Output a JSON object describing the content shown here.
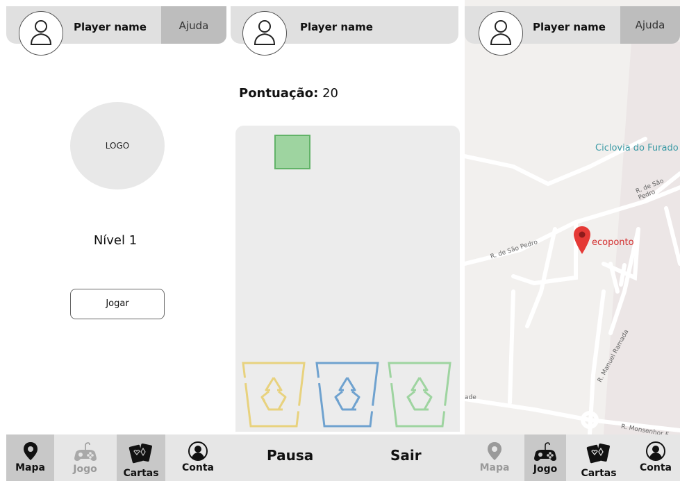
{
  "player": {
    "name": "Player name"
  },
  "header": {
    "help_label": "Ajuda"
  },
  "home": {
    "logo_text": "LOGO",
    "level": "Nível 1",
    "play_label": "Jogar"
  },
  "nav": {
    "items": [
      {
        "label": "Mapa",
        "icon": "map-pin-icon"
      },
      {
        "label": "Jogo",
        "icon": "gamepad-icon"
      },
      {
        "label": "Cartas",
        "icon": "cards-icon"
      },
      {
        "label": "Conta",
        "icon": "account-icon"
      }
    ]
  },
  "game": {
    "score_label": "Pontuação:",
    "score_value": "20",
    "pause_label": "Pausa",
    "exit_label": "Sair",
    "bins": [
      {
        "color": "#e8d27e"
      },
      {
        "color": "#6fa2cf"
      },
      {
        "color": "#9ed4a0"
      }
    ]
  },
  "map": {
    "marker_label": "ecoponto",
    "labels": {
      "ciclovia": "Ciclovia do Furado",
      "street1": "R. de São Pedro",
      "street2": "R. de São Pedro",
      "street3": "R. Manuel Ramada",
      "street4": "R. Monsenhor F",
      "edge_left": "ade"
    }
  },
  "colors": {
    "header_bg": "#e0e0e0",
    "help_bg": "#bdbdbd",
    "nav_bg": "#e6e6e6",
    "nav_active": "#c8c8c8",
    "marker": "#e53935",
    "park_text": "#3b9aa5"
  }
}
